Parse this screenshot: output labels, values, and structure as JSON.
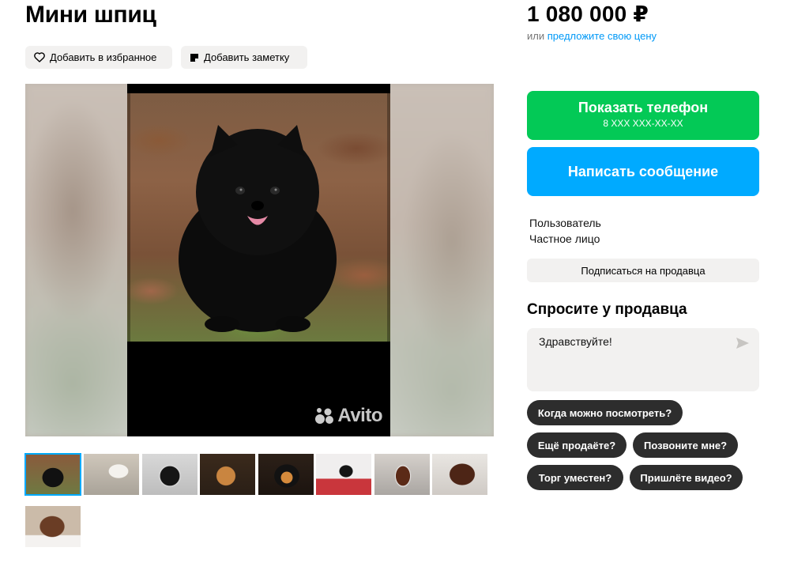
{
  "listing": {
    "title": "Мини шпиц"
  },
  "actions": {
    "favorite_label": "Добавить в избранное",
    "note_label": "Добавить заметку"
  },
  "gallery": {
    "watermark": "Avito",
    "thumbnails": [
      {
        "name": "black-spitz"
      },
      {
        "name": "white-spitz"
      },
      {
        "name": "black-white-spitz"
      },
      {
        "name": "orange-spitz"
      },
      {
        "name": "black-tan-spitz"
      },
      {
        "name": "black-white-puppy"
      },
      {
        "name": "brown-white-spitz"
      },
      {
        "name": "brown-spitz"
      },
      {
        "name": "brown-puppy"
      }
    ],
    "active_index": 0
  },
  "price": {
    "amount": "1 080 000 ₽",
    "prefix": "или",
    "offer_link": "предложите свою цену"
  },
  "contact": {
    "phone_label": "Показать телефон",
    "phone_mask": "8 XXX XXX-XX-XX",
    "message_label": "Написать сообщение"
  },
  "seller": {
    "name": "Пользователь",
    "type": "Частное лицо",
    "subscribe_label": "Подписаться на продавца"
  },
  "ask": {
    "title": "Спросите у продавца",
    "message_value": "Здравствуйте!",
    "quick_replies": [
      "Когда можно посмотреть?",
      "Ещё продаёте?",
      "Позвоните мне?",
      "Торг уместен?",
      "Пришлёте видео?"
    ]
  },
  "colors": {
    "green": "#03c956",
    "blue": "#00aaff",
    "chip_bg": "#f2f1f0",
    "pill_bg": "#2d2d2d",
    "link": "#0099f7"
  }
}
